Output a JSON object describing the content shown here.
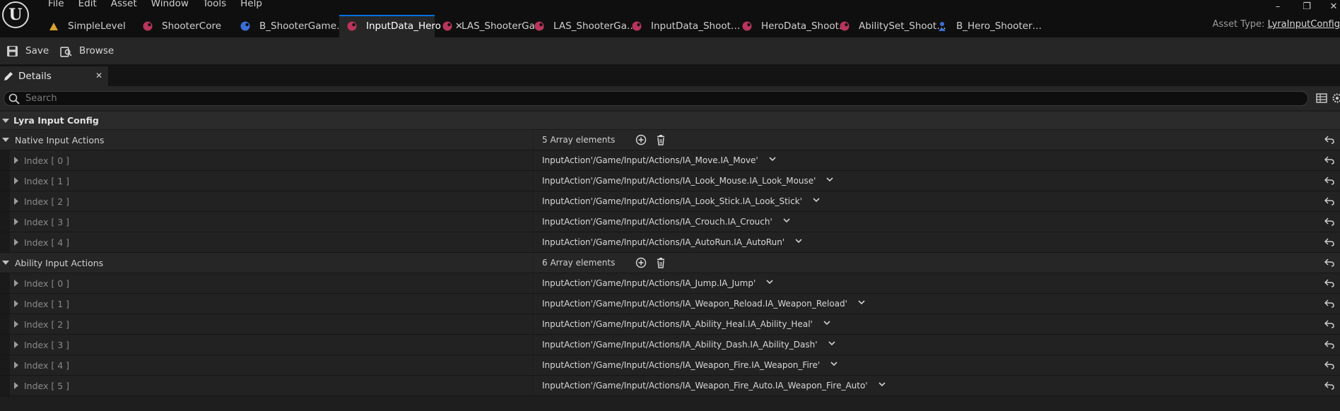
{
  "menu": [
    "File",
    "Edit",
    "Asset",
    "Window",
    "Tools",
    "Help"
  ],
  "tabs": [
    {
      "label": "SimpleLevel",
      "icon": "level-icon",
      "color": "#d9a130",
      "width": 165
    },
    {
      "label": "ShooterCore",
      "icon": "data-asset-icon",
      "color": "#b8345a",
      "width": 165
    },
    {
      "label": "B_ShooterGame…",
      "icon": "blueprint-icon",
      "color": "#3a6fd8",
      "width": 165
    },
    {
      "label": "InputData_Hero",
      "icon": "data-asset-icon",
      "color": "#b8345a",
      "width": 165,
      "active": true
    },
    {
      "label": "LAS_ShooterGa…",
      "icon": "data-asset-icon",
      "color": "#b8345a",
      "width": 165
    },
    {
      "label": "LAS_ShooterGa…",
      "icon": "data-asset-icon",
      "color": "#b8345a",
      "width": 165
    },
    {
      "label": "InputData_Shoot…",
      "icon": "data-asset-icon",
      "color": "#b8345a",
      "width": 165
    },
    {
      "label": "HeroData_Shoot…",
      "icon": "data-asset-icon",
      "color": "#b8345a",
      "width": 165
    },
    {
      "label": "AbilitySet_Shoot…",
      "icon": "data-asset-icon",
      "color": "#b8345a",
      "width": 165
    },
    {
      "label": "B_Hero_Shooter…",
      "icon": "character-blueprint-icon",
      "color": "#3a6fd8",
      "width": 165
    }
  ],
  "asset_type": {
    "label": "Asset Type:",
    "value": "LyraInputConfig"
  },
  "toolbar": {
    "save": "Save",
    "browse": "Browse"
  },
  "panel": {
    "title": "Details"
  },
  "search": {
    "placeholder": "Search"
  },
  "category": {
    "title": "Lyra Input Config"
  },
  "native": {
    "label": "Native Input Actions",
    "count": "5 Array elements",
    "items": [
      {
        "index": "Index [ 0 ]",
        "value": "InputAction'/Game/Input/Actions/IA_Move.IA_Move'"
      },
      {
        "index": "Index [ 1 ]",
        "value": "InputAction'/Game/Input/Actions/IA_Look_Mouse.IA_Look_Mouse'"
      },
      {
        "index": "Index [ 2 ]",
        "value": "InputAction'/Game/Input/Actions/IA_Look_Stick.IA_Look_Stick'"
      },
      {
        "index": "Index [ 3 ]",
        "value": "InputAction'/Game/Input/Actions/IA_Crouch.IA_Crouch'"
      },
      {
        "index": "Index [ 4 ]",
        "value": "InputAction'/Game/Input/Actions/IA_AutoRun.IA_AutoRun'"
      }
    ]
  },
  "ability": {
    "label": "Ability Input Actions",
    "count": "6 Array elements",
    "items": [
      {
        "index": "Index [ 0 ]",
        "value": "InputAction'/Game/Input/Actions/IA_Jump.IA_Jump'"
      },
      {
        "index": "Index [ 1 ]",
        "value": "InputAction'/Game/Input/Actions/IA_Weapon_Reload.IA_Weapon_Reload'"
      },
      {
        "index": "Index [ 2 ]",
        "value": "InputAction'/Game/Input/Actions/IA_Ability_Heal.IA_Ability_Heal'"
      },
      {
        "index": "Index [ 3 ]",
        "value": "InputAction'/Game/Input/Actions/IA_Ability_Dash.IA_Ability_Dash'"
      },
      {
        "index": "Index [ 4 ]",
        "value": "InputAction'/Game/Input/Actions/IA_Weapon_Fire.IA_Weapon_Fire'"
      },
      {
        "index": "Index [ 5 ]",
        "value": "InputAction'/Game/Input/Actions/IA_Weapon_Fire_Auto.IA_Weapon_Fire_Auto'"
      }
    ]
  }
}
